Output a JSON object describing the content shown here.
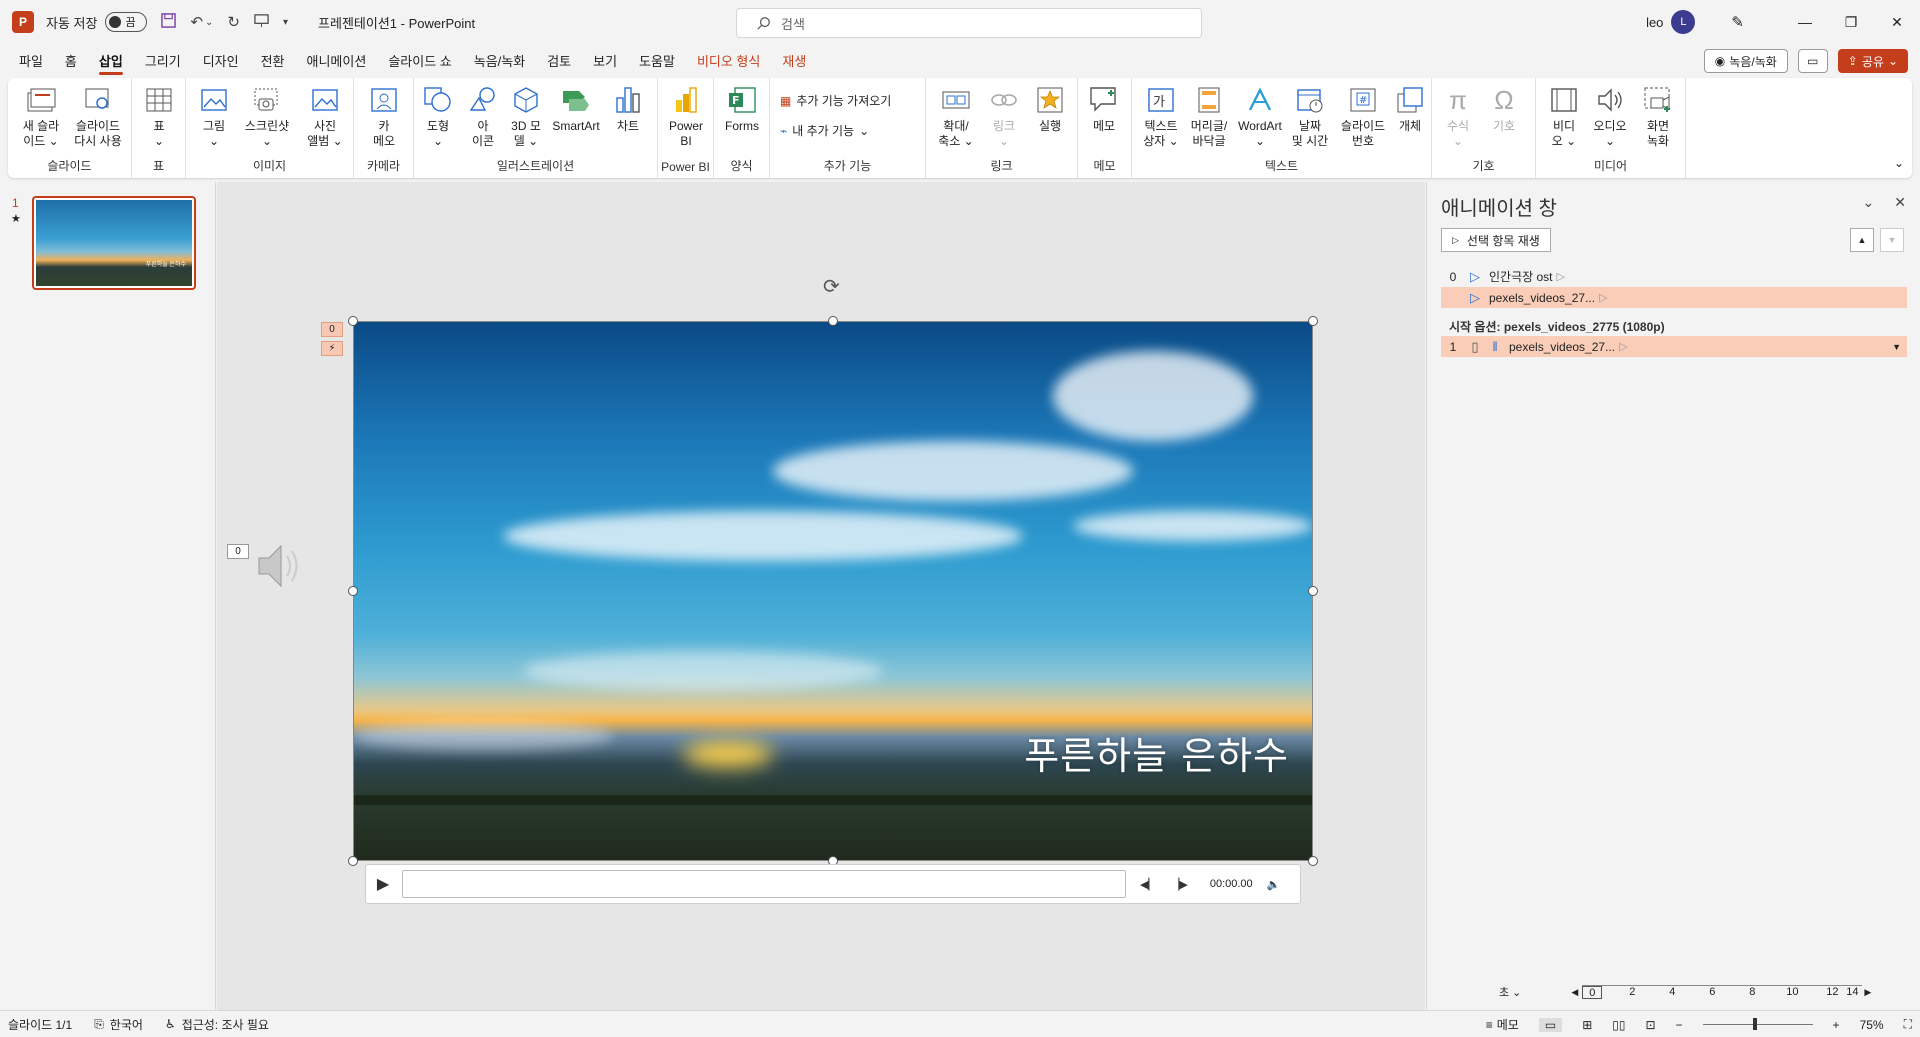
{
  "titlebar": {
    "app_icon": "P",
    "autosave_label": "자동 저장",
    "autosave_state": "끔",
    "doc_title": "프레젠테이션1",
    "app_name": "PowerPoint",
    "separator": "-",
    "search_placeholder": "검색",
    "user_name": "leo",
    "user_initial": "L"
  },
  "menu": {
    "tabs": [
      "파일",
      "홈",
      "삽입",
      "그리기",
      "디자인",
      "전환",
      "애니메이션",
      "슬라이드 쇼",
      "녹음/녹화",
      "검토",
      "보기",
      "도움말",
      "비디오 형식",
      "재생"
    ],
    "active_tab": "삽입",
    "record_label": "녹음/녹화",
    "share_label": "공유"
  },
  "ribbon": {
    "groups": {
      "slides": "슬라이드",
      "table": "표",
      "images": "이미지",
      "camera": "카메라",
      "illustrations": "일러스트레이션",
      "powerbi": "Power BI",
      "forms": "양식",
      "addins": "추가 기능",
      "links": "링크",
      "comments": "메모",
      "text": "텍스트",
      "symbols": "기호",
      "media": "미디어"
    },
    "buttons": {
      "new_slide": [
        "새 슬라",
        "이드 ⌄"
      ],
      "reuse_slides": [
        "슬라이드",
        "다시 사용"
      ],
      "table": [
        "표",
        "⌄"
      ],
      "pictures": [
        "그림",
        "⌄"
      ],
      "screenshot": [
        "스크린샷",
        "⌄"
      ],
      "photo_album": [
        "사진",
        "앨범 ⌄"
      ],
      "cameo": [
        "카",
        "메오"
      ],
      "shapes": [
        "도형",
        "⌄"
      ],
      "icons": [
        "아",
        "이콘"
      ],
      "models3d": [
        "3D 모",
        "델 ⌄"
      ],
      "smartart": [
        "SmartArt"
      ],
      "chart": [
        "차트"
      ],
      "powerbi": [
        "Power",
        "BI"
      ],
      "forms": [
        "Forms"
      ],
      "get_addins": "추가 기능 가져오기",
      "my_addins": "내 추가 기능",
      "zoom": [
        "확대/",
        "축소 ⌄"
      ],
      "link": [
        "링크",
        "⌄"
      ],
      "action": [
        "실행"
      ],
      "comment": [
        "메모"
      ],
      "textbox": [
        "텍스트",
        "상자 ⌄"
      ],
      "header_footer": [
        "머리글/",
        "바닥글"
      ],
      "wordart": [
        "WordArt",
        "⌄"
      ],
      "date_time": [
        "날짜",
        "및 시간"
      ],
      "slide_number": [
        "슬라이드",
        "번호"
      ],
      "object": [
        "개체"
      ],
      "equation": [
        "수식",
        "⌄"
      ],
      "symbol": [
        "기호"
      ],
      "video": [
        "비디",
        "오 ⌄"
      ],
      "audio": [
        "오디오",
        "⌄"
      ],
      "screen_recording": [
        "화면",
        "녹화"
      ]
    }
  },
  "thumbnails": {
    "slide_number": "1",
    "star": "★",
    "thumb_text": "푸른하늘 은하수"
  },
  "slide": {
    "title": "푸른하늘 은하수",
    "anim_tag_0": "0",
    "anim_tag_lightning": "⚡",
    "audio_tag": "0"
  },
  "player": {
    "time": "00:00.00"
  },
  "animpane": {
    "title": "애니메이션 창",
    "play_selected": "선택 항목 재생",
    "items": [
      {
        "index": "0",
        "label": "인간극장 ost"
      },
      {
        "index": "",
        "label": "pexels_videos_27..."
      }
    ],
    "section_title": "시작 옵션: pexels_videos_2775 (1080p)",
    "items2": [
      {
        "index": "1",
        "label": "pexels_videos_27..."
      }
    ],
    "timeline_unit": "초 ⌄",
    "timeline_ticks": [
      "0",
      "2",
      "4",
      "6",
      "8",
      "10",
      "12",
      "14"
    ]
  },
  "status": {
    "slide_info": "슬라이드 1/1",
    "language": "한국어",
    "accessibility": "접근성: 조사 필요",
    "notes": "메모",
    "zoom": "75%"
  },
  "colors": {
    "accent": "#c43e1c",
    "highlight": "#f9cdb8",
    "anim_icon": "#2e6fd0"
  }
}
